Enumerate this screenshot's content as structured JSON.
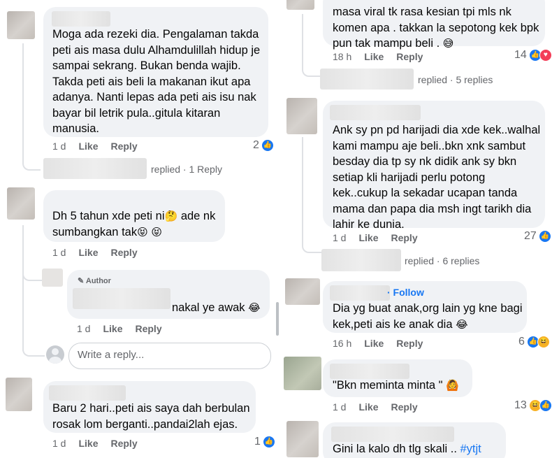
{
  "left": {
    "c1": {
      "text": "Moga ada rezeki dia. Pengalaman takda\npeti ais masa dulu Alhamdulillah hidup je\nsampai sekrang. Bukan benda wajib.\nTakda peti ais beli la makanan ikut apa\nadanya. Nanti lepas ada peti ais isu nak\nbayar bil letrik pula..gitula kitaran\nmanusia.",
      "time": "1 d",
      "like": "Like",
      "reply": "Reply",
      "react_count": "2",
      "replied": "replied",
      "replies_count": "· 1 Reply"
    },
    "c2": {
      "text": "Dh 5 tahun xde peti ni",
      "text2": "ade nk\nsumbangkan tak",
      "time": "1 d",
      "like": "Like",
      "reply": "Reply"
    },
    "c2r": {
      "author_label": "Author",
      "text": "nakal ye awak",
      "time": "1 d",
      "like": "Like",
      "reply": "Reply"
    },
    "write": {
      "placeholder": "Write a reply..."
    },
    "c3": {
      "text": "Baru 2 hari..peti ais saya dah berbulan\nrosak lom berganti..pandai2lah ejas.",
      "time": "1 d",
      "like": "Like",
      "reply": "Reply",
      "react_count": "1"
    }
  },
  "right": {
    "c1": {
      "text": "masa viral tk rasa kesian tpi mls nk\nkomen apa . takkan la sepotong kek bpk\npun tak mampu beli .",
      "time": "18 h",
      "like": "Like",
      "reply": "Reply",
      "react_count": "14",
      "replied": "replied",
      "replies_count": "· 5 replies"
    },
    "c2": {
      "text": "Ank sy pn pd harijadi dia xde kek..walhal\nkami mampu aje beli..bkn xnk sambut\nbesday dia tp sy nk didik ank sy bkn\nsetiap kli harijadi perlu potong\nkek..cukup la sekadar ucapan tanda\nmama dan papa dia msh ingt tarikh dia\nlahir ke dunia.",
      "time": "1 d",
      "like": "Like",
      "reply": "Reply",
      "react_count": "27",
      "replied": "replied",
      "replies_count": "· 6 replies"
    },
    "c3": {
      "follow": "· Follow",
      "text": "Dia yg buat anak,org lain yg kne bagi\nkek,peti ais ke anak dia",
      "time": "16 h",
      "like": "Like",
      "reply": "Reply",
      "react_count": "6"
    },
    "c4": {
      "text": "\"Bkn meminta minta \"",
      "time": "1 d",
      "like": "Like",
      "reply": "Reply",
      "react_count": "13"
    },
    "c5": {
      "text": "Gini la kalo dh tlg skali .. ",
      "hashtag": "#ytjt"
    }
  },
  "icons": {
    "like": "thumbs-up-icon",
    "haha": "laughing-face-icon",
    "love": "heart-icon",
    "author": "pencil-icon",
    "sweat": "grinning-sweat-emoji",
    "think": "thinking-emoji",
    "tongue": "squinting-tongue-emoji",
    "joy": "tears-of-joy-emoji",
    "shrug": "person-gesturing-emoji"
  },
  "colors": {
    "bubble": "#f0f2f5",
    "meta": "#65676b",
    "link": "#1877f2",
    "like_badge": "#1877f2"
  }
}
